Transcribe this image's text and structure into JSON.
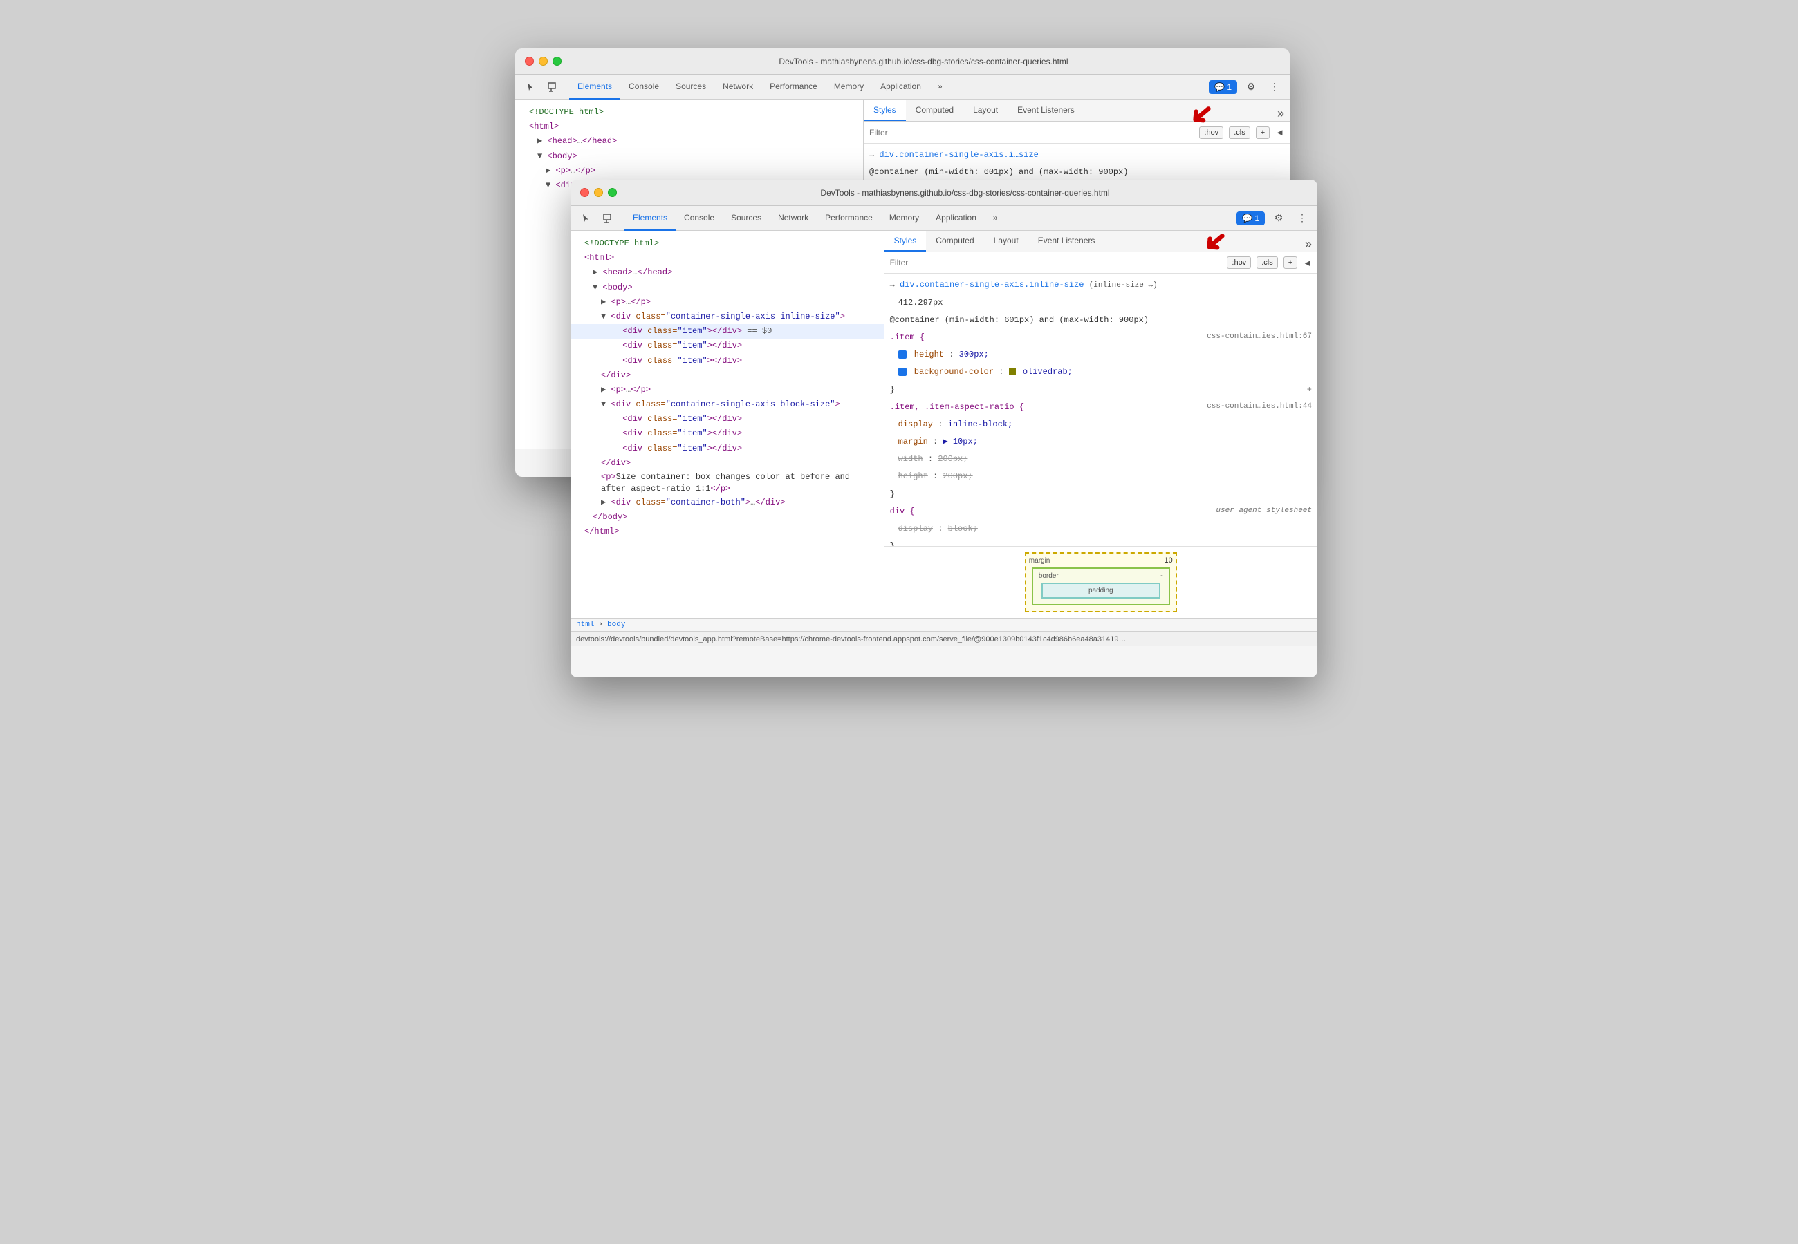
{
  "back_window": {
    "title": "DevTools - mathiasbynens.github.io/css-dbg-stories/css-container-queries.html",
    "tabs": [
      "Elements",
      "Console",
      "Sources",
      "Network",
      "Performance",
      "Memory",
      "Application"
    ],
    "active_tab": "Elements",
    "style_tabs": [
      "Styles",
      "Computed",
      "Layout",
      "Event Listeners"
    ],
    "active_style_tab": "Styles",
    "filter_placeholder": "Filter",
    "filter_actions": [
      ":hov",
      ".cls",
      "+"
    ],
    "html_lines": [
      {
        "text": "<!DOCTYPE html>",
        "indent": 0,
        "type": "comment"
      },
      {
        "text": "<html>",
        "indent": 0,
        "type": "tag"
      },
      {
        "text": "▶ <head>…</head>",
        "indent": 1,
        "type": "collapsed"
      },
      {
        "text": "▼ <body>",
        "indent": 1,
        "type": "tag"
      },
      {
        "text": "▶ <p>…</p>",
        "indent": 2,
        "type": "collapsed"
      },
      {
        "text": "▼ <div class=\"container-single-axis inline-size\">",
        "indent": 2,
        "type": "tag"
      }
    ],
    "css_rules": [
      {
        "selector": "→ div.container-single-axis.i…size",
        "source": ""
      },
      {
        "at_rule": "@container (min-width: 601px) and (max-width: 900px)"
      },
      {
        "selector": ".item {",
        "source": "css-contain…ies.html:67"
      }
    ]
  },
  "front_window": {
    "title": "DevTools - mathiasbynens.github.io/css-dbg-stories/css-container-queries.html",
    "tabs": [
      "Elements",
      "Console",
      "Sources",
      "Network",
      "Performance",
      "Memory",
      "Application"
    ],
    "active_tab": "Elements",
    "style_tabs": [
      "Styles",
      "Computed",
      "Layout",
      "Event Listeners"
    ],
    "active_style_tab": "Styles",
    "filter_placeholder": "Filter",
    "filter_actions": [
      ":hov",
      ".cls",
      "+"
    ],
    "html_lines": [
      {
        "text": "<!DOCTYPE html>",
        "indent": 0,
        "type": "comment"
      },
      {
        "text": "<html>",
        "indent": 0,
        "type": "tag"
      },
      {
        "text": "▶ <head>…</head>",
        "indent": 1,
        "type": "collapsed"
      },
      {
        "text": "▼ <body>",
        "indent": 1,
        "type": "tag"
      },
      {
        "text": "▶ <p>…</p>",
        "indent": 2,
        "type": "collapsed"
      },
      {
        "text": "▼ <div class=\"container-single-axis inline-size\">",
        "indent": 2,
        "type": "tag"
      },
      {
        "text": "<div class=\"item\"></div>  == $0",
        "indent": 3,
        "type": "selected"
      },
      {
        "text": "<div class=\"item\"></div>",
        "indent": 3,
        "type": "tag"
      },
      {
        "text": "<div class=\"item\"></div>",
        "indent": 3,
        "type": "tag"
      },
      {
        "text": "</div>",
        "indent": 2,
        "type": "tag"
      },
      {
        "text": "▶ <p>…</p>",
        "indent": 2,
        "type": "collapsed"
      },
      {
        "text": "▼ <div class=\"container-single-axis block-size\">",
        "indent": 2,
        "type": "tag"
      },
      {
        "text": "<div class=\"item\"></div>",
        "indent": 3,
        "type": "tag"
      },
      {
        "text": "<div class=\"item\"></div>",
        "indent": 3,
        "type": "tag"
      },
      {
        "text": "<div class=\"item\"></div>",
        "indent": 3,
        "type": "tag"
      },
      {
        "text": "</div>",
        "indent": 2,
        "type": "tag"
      },
      {
        "text": "<p>Size container: box changes color at before and after aspect-ratio 1:1</p>",
        "indent": 2,
        "type": "text"
      },
      {
        "text": "▶ <div class=\"container-both\">…</div>",
        "indent": 2,
        "type": "collapsed"
      },
      {
        "text": "</body>",
        "indent": 1,
        "type": "tag"
      },
      {
        "text": "</html>",
        "indent": 0,
        "type": "tag"
      }
    ],
    "css_rules": [
      {
        "selector": "→ div.container-single-axis.inline-size",
        "suffix": "(inline-size ↔)",
        "link": true
      },
      {
        "plain": "412.297px"
      },
      {
        "at_rule": "@container (min-width: 601px) and (max-width: 900px)"
      },
      {
        "selector": ".item {",
        "source": "css-contain…ies.html:67",
        "properties": [
          {
            "name": "height",
            "value": "300px;",
            "checked": true,
            "strikethrough": false
          },
          {
            "name": "background-color",
            "value": "olivedrab;",
            "checked": true,
            "strikethrough": false,
            "swatch": true
          }
        ]
      },
      {
        "selector": ".item, .item-aspect-ratio {",
        "source": "css-contain…ies.html:44",
        "properties": [
          {
            "name": "display",
            "value": "inline-block;",
            "checked": false,
            "strikethrough": false
          },
          {
            "name": "margin",
            "value": "▶ 10px;",
            "checked": false,
            "strikethrough": false
          },
          {
            "name": "width",
            "value": "200px;",
            "checked": false,
            "strikethrough": true
          },
          {
            "name": "height",
            "value": "200px;",
            "checked": false,
            "strikethrough": true
          }
        ]
      },
      {
        "selector": "div {",
        "source": "user agent stylesheet",
        "properties": [
          {
            "name": "display",
            "value": "block;",
            "checked": false,
            "strikethrough": true
          }
        ]
      }
    ],
    "box_model": {
      "margin_label": "margin",
      "margin_value": "10",
      "border_label": "border",
      "border_value": "-",
      "padding_label": "padding"
    },
    "status_bar": "devtools://devtools/bundled/devtools_app.html?remoteBase=https://chrome-devtools-frontend.appspot.com/serve_file/@900e1309b0143f1c4d986b6ea48a31419…",
    "breadcrumb": [
      "html",
      "body"
    ]
  },
  "icons": {
    "cursor": "⬡",
    "inspect": "□",
    "more": "»",
    "settings": "⚙",
    "menu": "⋮",
    "chat": "💬",
    "add": "+",
    "close_style": "◄"
  }
}
